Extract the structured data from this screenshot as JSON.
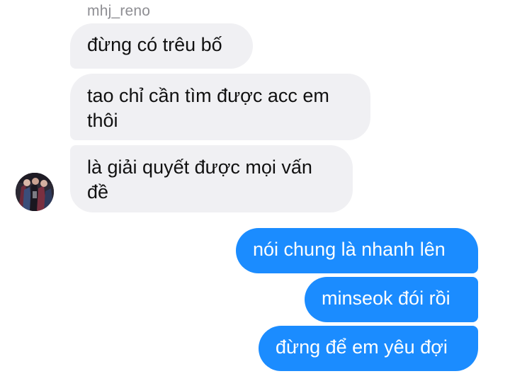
{
  "chat": {
    "sender_name": "mhj_reno",
    "incoming_messages": [
      "đừng có trêu bố",
      "tao chỉ cần tìm được acc em thôi",
      "là giải quyết được mọi vấn đề"
    ],
    "outgoing_messages": [
      "nói chung là nhanh lên",
      "minseok đói rồi",
      "đừng để em yêu đợi"
    ]
  },
  "colors": {
    "incoming_bubble": "#f0f0f3",
    "outgoing_bubble": "#1b8cff",
    "sender_name_text": "#8e8e93"
  },
  "icons": {
    "avatar": "profile-photo"
  }
}
